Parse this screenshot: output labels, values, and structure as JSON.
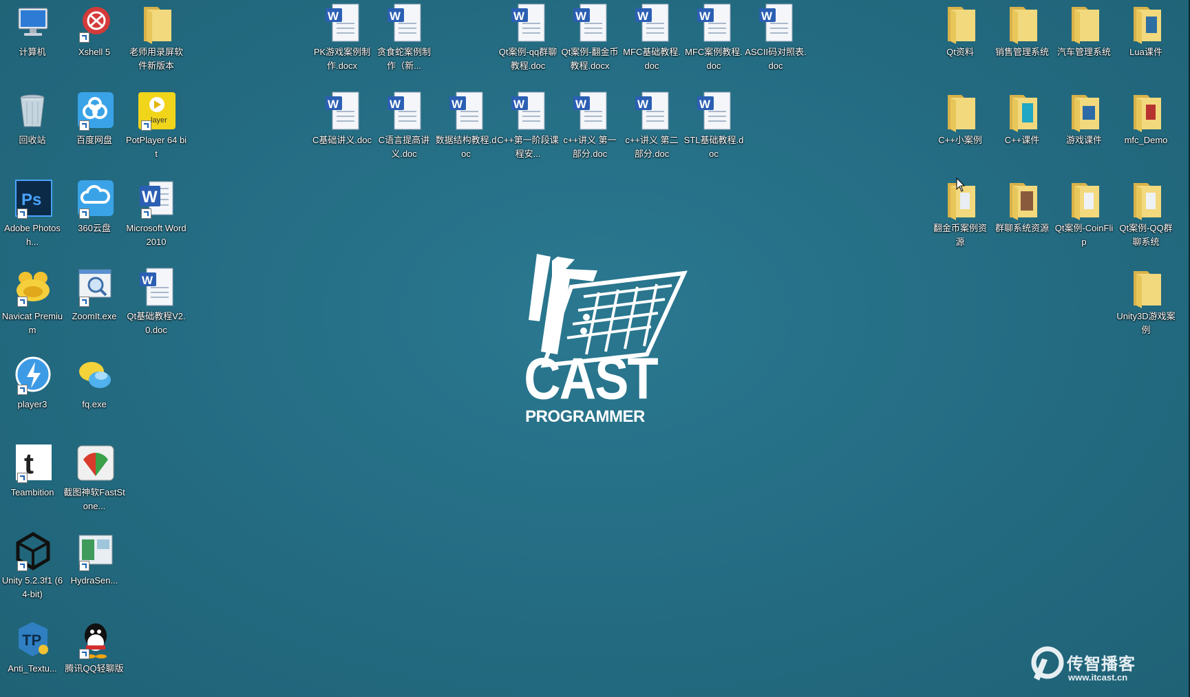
{
  "desktop": {
    "left_icons": [
      {
        "label": "计算机",
        "icon": "computer-icon",
        "name": "desktop-icon-computer"
      },
      {
        "label": "Xshell 5",
        "icon": "xshell-icon",
        "name": "desktop-icon-xshell"
      },
      {
        "label": "老师用录屏软件新版本",
        "icon": "folder-icon",
        "name": "desktop-icon-recorder-folder"
      },
      {
        "label": "回收站",
        "icon": "recycle-bin-icon",
        "name": "desktop-icon-recycle-bin"
      },
      {
        "label": "百度网盘",
        "icon": "baidu-netdisk-icon",
        "name": "desktop-icon-baidu-netdisk"
      },
      {
        "label": "PotPlayer 64 bit",
        "icon": "potplayer-icon",
        "name": "desktop-icon-potplayer"
      },
      {
        "label": "Adobe Photosh...",
        "icon": "photoshop-icon",
        "name": "desktop-icon-photoshop"
      },
      {
        "label": "360云盘",
        "icon": "cloud-icon",
        "name": "desktop-icon-360-cloud"
      },
      {
        "label": "Microsoft Word 2010",
        "icon": "word-icon",
        "name": "desktop-icon-word"
      },
      {
        "label": "Navicat Premium",
        "icon": "navicat-icon",
        "name": "desktop-icon-navicat"
      },
      {
        "label": "ZoomIt.exe",
        "icon": "zoomit-icon",
        "name": "desktop-icon-zoomit"
      },
      {
        "label": "Qt基础教程V2.0.doc",
        "icon": "word-doc-icon",
        "name": "desktop-icon-qt-basic-doc"
      },
      {
        "label": "player3",
        "icon": "player3-icon",
        "name": "desktop-icon-player3"
      },
      {
        "label": "fq.exe",
        "icon": "fq-icon",
        "name": "desktop-icon-fq"
      },
      {
        "label": "Teambition",
        "icon": "teambition-icon",
        "name": "desktop-icon-teambition"
      },
      {
        "label": "截图神软FastStone...",
        "icon": "faststone-icon",
        "name": "desktop-icon-faststone"
      },
      {
        "label": "Unity 5.2.3f1 (64-bit)",
        "icon": "unity-icon",
        "name": "desktop-icon-unity"
      },
      {
        "label": "HydraSen...",
        "icon": "hydra-icon",
        "name": "desktop-icon-hydra"
      },
      {
        "label": "Anti_Textu...",
        "icon": "anti-texture-icon",
        "name": "desktop-icon-anti-texture"
      },
      {
        "label": "腾讯QQ轻聊版",
        "icon": "qq-icon",
        "name": "desktop-icon-qq"
      }
    ],
    "doc_icons": [
      {
        "label": "PK游戏案例制作.docx",
        "name": "desktop-icon-pk-game-doc"
      },
      {
        "label": "贪食蛇案例制作（新...",
        "name": "desktop-icon-snake-doc"
      },
      {
        "label": "Qt案例-qq群聊教程.doc",
        "name": "desktop-icon-qt-qq-doc"
      },
      {
        "label": "Qt案例-翻金币教程.docx",
        "name": "desktop-icon-qt-coin-doc"
      },
      {
        "label": "MFC基础教程.doc",
        "name": "desktop-icon-mfc-basic-doc"
      },
      {
        "label": "MFC案例教程.doc",
        "name": "desktop-icon-mfc-case-doc"
      },
      {
        "label": "ASCII码对照表.doc",
        "name": "desktop-icon-ascii-doc"
      },
      {
        "label": "C基础讲义.doc",
        "name": "desktop-icon-c-basic-doc"
      },
      {
        "label": "C语言提高讲义.doc",
        "name": "desktop-icon-c-advanced-doc"
      },
      {
        "label": "数据结构教程.doc",
        "name": "desktop-icon-data-structure-doc"
      },
      {
        "label": "C++第一阶段课程安...",
        "name": "desktop-icon-cpp-schedule-doc"
      },
      {
        "label": "c++讲义 第一部分.doc",
        "name": "desktop-icon-cpp-part1-doc"
      },
      {
        "label": "c++讲义 第二部分.doc",
        "name": "desktop-icon-cpp-part2-doc"
      },
      {
        "label": "STL基础教程.doc",
        "name": "desktop-icon-stl-doc"
      }
    ],
    "right_icons": [
      {
        "label": "Qt资料",
        "name": "desktop-icon-qt-folder"
      },
      {
        "label": "销售管理系统",
        "name": "desktop-icon-sales-folder"
      },
      {
        "label": "汽车管理系统",
        "name": "desktop-icon-car-folder"
      },
      {
        "label": "Lua课件",
        "name": "desktop-icon-lua-folder"
      },
      {
        "label": "C++小案例",
        "name": "desktop-icon-cpp-case-folder"
      },
      {
        "label": "C++课件",
        "name": "desktop-icon-cpp-course-folder"
      },
      {
        "label": "游戏课件",
        "name": "desktop-icon-game-course-folder"
      },
      {
        "label": "mfc_Demo",
        "name": "desktop-icon-mfc-demo-folder"
      },
      {
        "label": "翻金币案例资源",
        "name": "desktop-icon-coin-res-folder"
      },
      {
        "label": "群聊系统资源",
        "name": "desktop-icon-chat-res-folder"
      },
      {
        "label": "Qt案例-CoinFlip",
        "name": "desktop-icon-coinflip-folder"
      },
      {
        "label": "Qt案例-QQ群聊系统",
        "name": "desktop-icon-qq-chat-folder"
      },
      {
        "label": "Unity3D游戏案例",
        "name": "desktop-icon-unity3d-folder"
      }
    ]
  },
  "wallpaper": {
    "logo_text": "CAST",
    "logo_subtitle": "PROGRAMMER",
    "brand_name": "传智播客",
    "brand_url": "www.itcast.cn"
  },
  "colors": {
    "background": "#236b80",
    "folder": "#e8c65a",
    "word_blue": "#2b5fb3"
  }
}
